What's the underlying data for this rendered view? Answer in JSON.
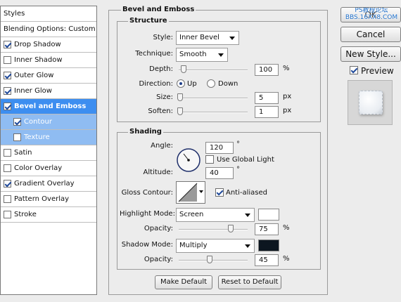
{
  "left_panel": {
    "items": [
      {
        "label": "Styles",
        "checkbox": false,
        "checked": false,
        "state": "header"
      },
      {
        "label": "Blending Options: Custom",
        "checkbox": false,
        "checked": false,
        "state": "normal"
      },
      {
        "label": "Drop Shadow",
        "checkbox": true,
        "checked": true,
        "state": "normal"
      },
      {
        "label": "Inner Shadow",
        "checkbox": true,
        "checked": false,
        "state": "normal"
      },
      {
        "label": "Outer Glow",
        "checkbox": true,
        "checked": true,
        "state": "normal"
      },
      {
        "label": "Inner Glow",
        "checkbox": true,
        "checked": true,
        "state": "normal"
      },
      {
        "label": "Bevel and Emboss",
        "checkbox": true,
        "checked": true,
        "state": "selected"
      },
      {
        "label": "Contour",
        "checkbox": true,
        "checked": true,
        "state": "sub"
      },
      {
        "label": "Texture",
        "checkbox": true,
        "checked": false,
        "state": "sub"
      },
      {
        "label": "Satin",
        "checkbox": true,
        "checked": false,
        "state": "normal"
      },
      {
        "label": "Color Overlay",
        "checkbox": true,
        "checked": false,
        "state": "normal"
      },
      {
        "label": "Gradient Overlay",
        "checkbox": true,
        "checked": true,
        "state": "normal"
      },
      {
        "label": "Pattern Overlay",
        "checkbox": true,
        "checked": false,
        "state": "normal"
      },
      {
        "label": "Stroke",
        "checkbox": true,
        "checked": false,
        "state": "normal"
      }
    ]
  },
  "bevel": {
    "title": "Bevel and Emboss",
    "structure": {
      "title": "Structure",
      "style_label": "Style:",
      "style_value": "Inner Bevel",
      "technique_label": "Technique:",
      "technique_value": "Smooth",
      "depth_label": "Depth:",
      "depth_value": "100",
      "depth_unit": "%",
      "depth_level": 0.07,
      "direction_label": "Direction:",
      "direction_up": "Up",
      "direction_down": "Down",
      "direction_selected": "Up",
      "size_label": "Size:",
      "size_value": "5",
      "size_unit": "px",
      "size_level": 0.02,
      "soften_label": "Soften:",
      "soften_value": "1",
      "soften_unit": "px",
      "soften_level": 0.02
    },
    "shading": {
      "title": "Shading",
      "angle_label": "Angle:",
      "angle_value": "120",
      "angle_unit": "°",
      "use_global_light_label": "Use Global Light",
      "use_global_light": false,
      "altitude_label": "Altitude:",
      "altitude_value": "40",
      "altitude_unit": "°",
      "gloss_contour_label": "Gloss Contour:",
      "anti_aliased_label": "Anti-aliased",
      "anti_aliased": true,
      "highlight_mode_label": "Highlight Mode:",
      "highlight_mode_value": "Screen",
      "highlight_color": "#ffffff",
      "highlight_opacity_label": "Opacity:",
      "highlight_opacity_value": "75",
      "highlight_opacity_unit": "%",
      "highlight_opacity_level": 0.75,
      "shadow_mode_label": "Shadow Mode:",
      "shadow_mode_value": "Multiply",
      "shadow_color": "#0c1620",
      "shadow_opacity_label": "Opacity:",
      "shadow_opacity_value": "45",
      "shadow_opacity_unit": "%",
      "shadow_opacity_level": 0.45
    },
    "make_default": "Make Default",
    "reset_default": "Reset to Default"
  },
  "right": {
    "ok_label": "OK",
    "watermark": "PS教程论坛 BBS.16XX8.COM",
    "cancel_label": "Cancel",
    "new_style_label": "New Style...",
    "preview_label": "Preview",
    "preview_checked": true
  },
  "colors": {
    "selected": "#3d8ef0",
    "sub_selected": "#8fbcf2"
  }
}
